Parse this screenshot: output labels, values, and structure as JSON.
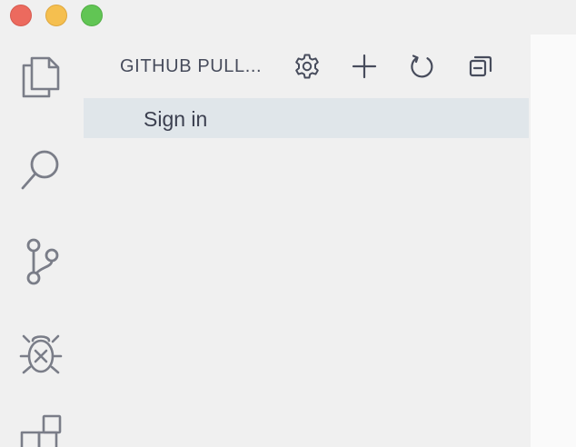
{
  "window": {
    "traffic_lights": [
      "close",
      "minimize",
      "maximize"
    ]
  },
  "activity_bar": {
    "items": [
      {
        "name": "explorer",
        "icon": "files-icon"
      },
      {
        "name": "search",
        "icon": "search-icon"
      },
      {
        "name": "source-control",
        "icon": "source-control-icon"
      },
      {
        "name": "debug",
        "icon": "debug-icon"
      },
      {
        "name": "extensions",
        "icon": "extensions-icon"
      }
    ]
  },
  "sidebar": {
    "title": "GITHUB PULL...",
    "actions": [
      {
        "name": "settings",
        "icon": "gear-icon"
      },
      {
        "name": "add",
        "icon": "plus-icon"
      },
      {
        "name": "refresh",
        "icon": "refresh-icon"
      },
      {
        "name": "collapse-all",
        "icon": "collapse-all-icon"
      }
    ],
    "items": [
      {
        "label": "Sign in"
      }
    ]
  },
  "colors": {
    "background": "#f0f0f0",
    "selected_row": "#e0e6ea",
    "icon": "#474c5c",
    "editor": "#fafafa"
  }
}
